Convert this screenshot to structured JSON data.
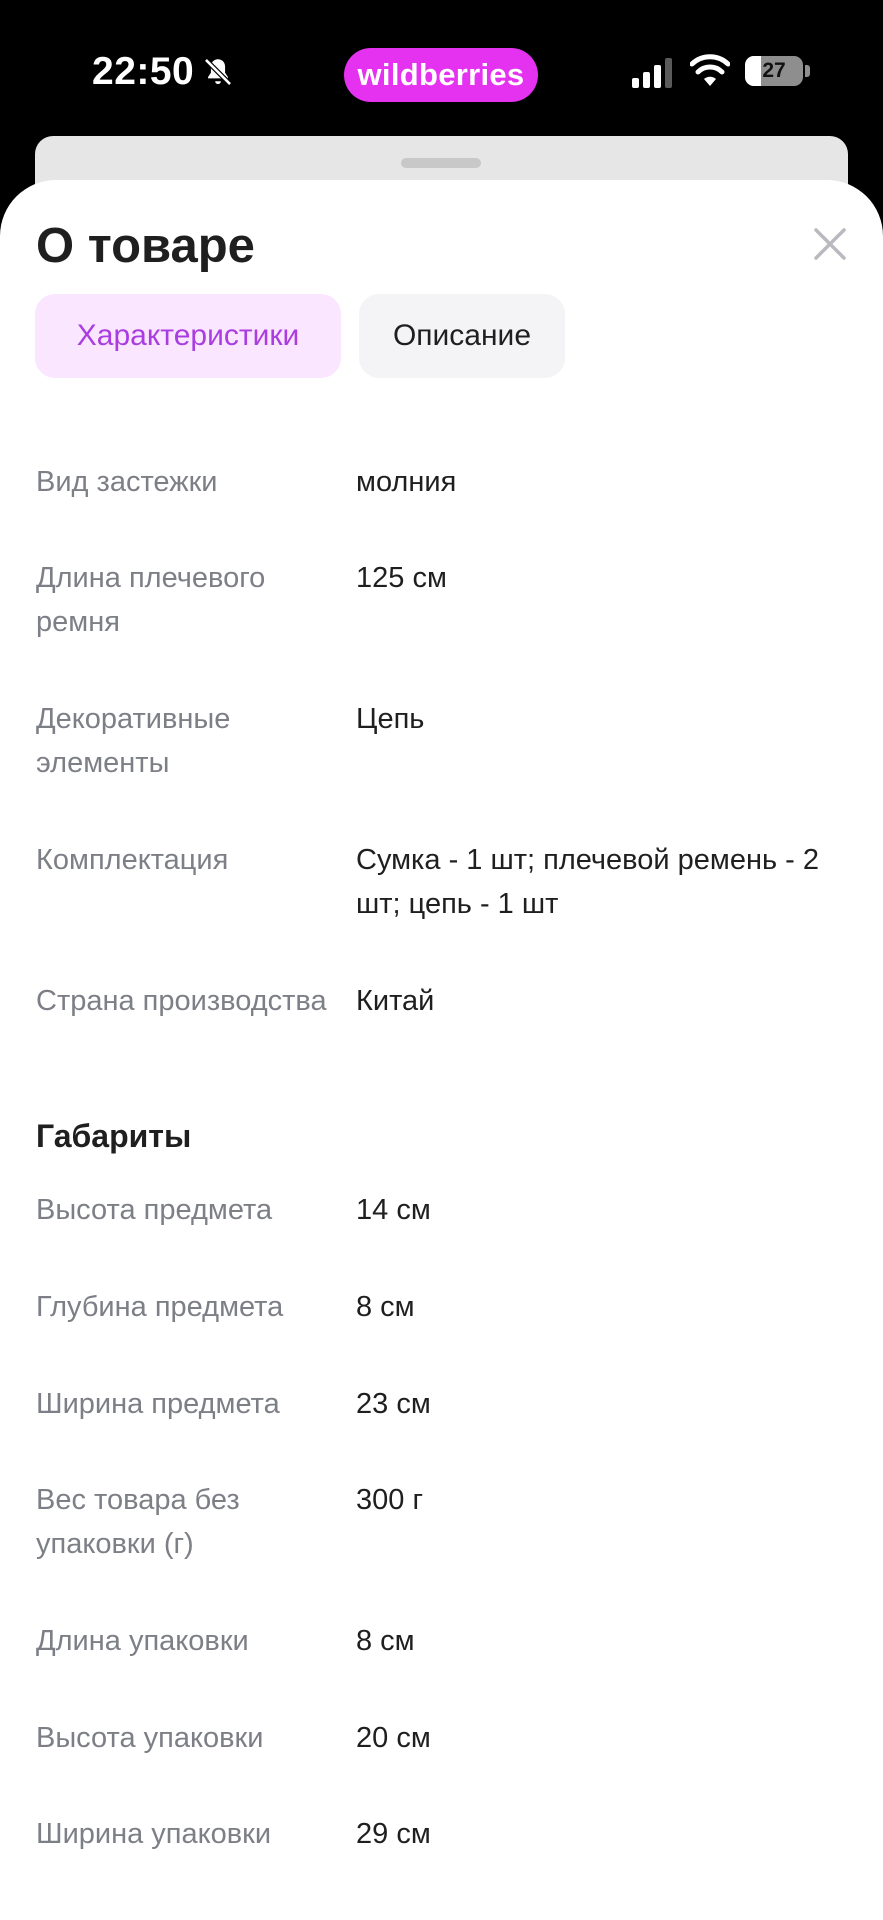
{
  "status_bar": {
    "time": "22:50",
    "app_badge": "wildberries",
    "battery": "27"
  },
  "sheet": {
    "title": "О товаре",
    "tabs": [
      {
        "label": "Характеристики",
        "active": true
      },
      {
        "label": "Описание",
        "active": false
      }
    ],
    "characteristics": [
      {
        "label": "Вид застежки",
        "value": "молния"
      },
      {
        "label": "Длина плечевого ремня",
        "value": "125 см"
      },
      {
        "label": "Декоративные элементы",
        "value": "Цепь"
      },
      {
        "label": "Комплектация",
        "value": "Сумка - 1 шт; плечевой ремень - 2 шт; цепь - 1 шт"
      },
      {
        "label": "Страна производства",
        "value": "Китай"
      }
    ],
    "dimensions_title": "Габариты",
    "dimensions": [
      {
        "label": "Высота предмета",
        "value": "14 см"
      },
      {
        "label": "Глубина предмета",
        "value": "8 см"
      },
      {
        "label": "Ширина предмета",
        "value": "23 см"
      },
      {
        "label": "Вес товара без упаковки (г)",
        "value": "300 г"
      },
      {
        "label": "Длина упаковки",
        "value": "8 см"
      },
      {
        "label": "Высота упаковки",
        "value": "20 см"
      },
      {
        "label": "Ширина упаковки",
        "value": "29 см"
      }
    ]
  },
  "colors": {
    "brand": "#e532f0",
    "tab_active_bg": "#fbe6ff",
    "tab_active_text": "#a93de0",
    "label_gray": "#7d7f86"
  }
}
